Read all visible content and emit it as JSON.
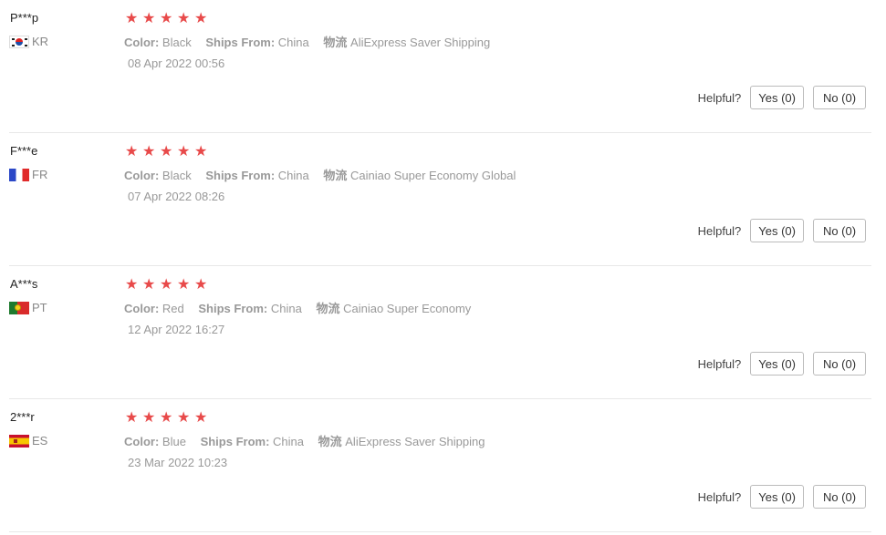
{
  "reviews": [
    {
      "user": "P***p",
      "country": "KR",
      "flag": "kr",
      "rating": 5,
      "color_label": "Color:",
      "color": "Black",
      "ships_label": "Ships From:",
      "ships_from": "China",
      "logistics_label": "物流",
      "logistics": "AliExpress Saver Shipping",
      "date": "08 Apr 2022 00:56",
      "helpful_label": "Helpful?",
      "yes_label": "Yes (0)",
      "no_label": "No (0)"
    },
    {
      "user": "F***e",
      "country": "FR",
      "flag": "fr",
      "rating": 5,
      "color_label": "Color:",
      "color": "Black",
      "ships_label": "Ships From:",
      "ships_from": "China",
      "logistics_label": "物流",
      "logistics": "Cainiao Super Economy Global",
      "date": "07 Apr 2022 08:26",
      "helpful_label": "Helpful?",
      "yes_label": "Yes (0)",
      "no_label": "No (0)"
    },
    {
      "user": "A***s",
      "country": "PT",
      "flag": "pt",
      "rating": 5,
      "color_label": "Color:",
      "color": "Red",
      "ships_label": "Ships From:",
      "ships_from": "China",
      "logistics_label": "物流",
      "logistics": "Cainiao Super Economy",
      "date": "12 Apr 2022 16:27",
      "helpful_label": "Helpful?",
      "yes_label": "Yes (0)",
      "no_label": "No (0)"
    },
    {
      "user": "2***r",
      "country": "ES",
      "flag": "es",
      "rating": 5,
      "color_label": "Color:",
      "color": "Blue",
      "ships_label": "Ships From:",
      "ships_from": "China",
      "logistics_label": "物流",
      "logistics": "AliExpress Saver Shipping",
      "date": "23 Mar 2022 10:23",
      "helpful_label": "Helpful?",
      "yes_label": "Yes (0)",
      "no_label": "No (0)"
    }
  ],
  "star_glyph": "★",
  "colors": {
    "star": "#e84a4a",
    "meta_text": "#999999",
    "divider": "#e8e8e8"
  }
}
